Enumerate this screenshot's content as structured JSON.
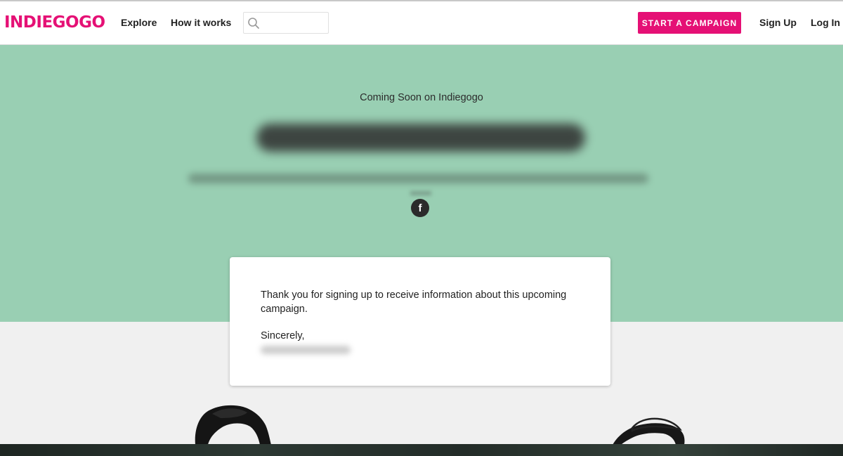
{
  "header": {
    "logo": "INDIEGOGO",
    "nav": {
      "explore": "Explore",
      "how_it_works": "How it works"
    },
    "search": {
      "placeholder": ""
    },
    "cta": "START A CAMPAIGN",
    "sign_up": "Sign Up",
    "log_in": "Log In"
  },
  "hero": {
    "kicker": "Coming Soon on Indiegogo",
    "social": {
      "facebook_glyph": "f"
    }
  },
  "card": {
    "message": "Thank you for signing up to receive information about this upcoming campaign.",
    "signoff": "Sincerely,"
  },
  "colors": {
    "brand": "#e51075",
    "hero_bg": "#99cfb3",
    "page_bg": "#f0f0f0"
  }
}
